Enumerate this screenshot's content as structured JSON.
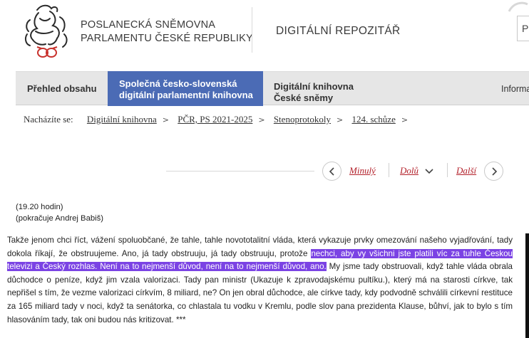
{
  "header": {
    "org_line1": "POSLANECKÁ SNĚMOVNA",
    "org_line2": "PARLAMENTU ČESKÉ REPUBLIKY",
    "repository": "DIGITÁLNÍ REPOZITÁŘ",
    "right_cut_text": "P"
  },
  "nav": {
    "tabs": [
      {
        "line1": "Přehled obsahu",
        "line2": ""
      },
      {
        "line1": "Společná česko-slovenská",
        "line2": "digitální parlamentní knihovna"
      },
      {
        "line1": "Digitální knihovna",
        "line2": "České sněmy"
      },
      {
        "line1": "Informa",
        "line2": ""
      }
    ]
  },
  "breadcrumb": {
    "label": "Nacházíte se:",
    "items": [
      "Digitální knihovna",
      "PČR, PS 2021-2025",
      "Stenoprotokoly",
      "124. schůze"
    ]
  },
  "pager": {
    "prev": "Minulý",
    "down": "Dolů",
    "next": "Další"
  },
  "speech": {
    "time": "(19.20 hodin)",
    "speaker": "(pokračuje Andrej Babiš)",
    "text_before": "Takže jenom chci říct, vážení spoluobčané, že tahle, tahle novototalitní vláda, která vykazuje prvky omezování našeho vyjadřování, tady dokola říkají, že obstruujeme. Ano, já tady obstruuju, já tady obstruuju, protože ",
    "highlighted": "nechci, aby vy všichni jste platili víc za tuhle Českou televizi a Český rozhlas. Není na to nejmenší důvod, není na to nejmenší důvod, ano.",
    "text_after": " My jsme tady obstruovali, když tahle vláda obrala důchodce o peníze, když jim vzala valorizaci. Tady pan ministr (Ukazuje k zpravodajskému pultíku.), který má na starosti církve, tak nepřišel s tím, že vezme valorizaci církvím, 8 miliard, ne? On jen obral důchodce, ale církve tady, kdy podvodně schválili církevní restituce za 165 miliard tady v noci, když ta senátorka, co chlastala tu vodku v Kremlu, podle slov pana prezidenta Klause, bůhví, jak to bylo s tím hlasováním tady, tak oni budou nás kritizovat. ***"
  },
  "colors": {
    "accent_tab": "#4b6bb5",
    "highlight": "#7b43e4",
    "link_red": "#b3202a",
    "logo_red": "#c8312c"
  }
}
